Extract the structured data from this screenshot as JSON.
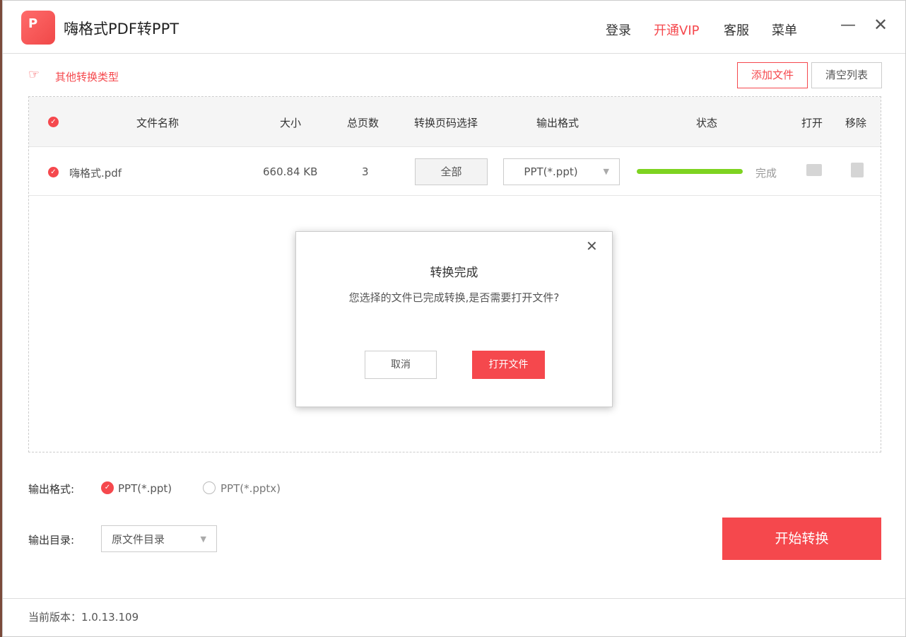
{
  "app": {
    "title": "嗨格式PDF转PPT",
    "nav": [
      "登录",
      "开通VIP",
      "客服",
      "菜单"
    ]
  },
  "toolbar": {
    "other_types": "其他转换类型",
    "add_file": "添加文件",
    "clear_list": "清空列表"
  },
  "table": {
    "headers": [
      "文件名称",
      "大小",
      "总页数",
      "转换页码选择",
      "输出格式",
      "状态",
      "打开",
      "移除"
    ],
    "rows": [
      {
        "name": "嗨格式.pdf",
        "size": "660.84 KB",
        "pages": "3",
        "page_select": "全部",
        "format": "PPT(*.ppt)",
        "progress": 100,
        "status": "完成"
      }
    ]
  },
  "output": {
    "format_label": "输出格式:",
    "options": [
      "PPT(*.ppt)",
      "PPT(*.pptx)"
    ],
    "selected": "PPT(*.ppt)",
    "dir_label": "输出目录:",
    "dir_value": "原文件目录"
  },
  "start_button": "开始转换",
  "version": "当前版本：1.0.13.109",
  "dialog": {
    "title": "转换完成",
    "message": "您选择的文件已完成转换,是否需要打开文件?",
    "cancel": "取消",
    "open": "打开文件"
  }
}
